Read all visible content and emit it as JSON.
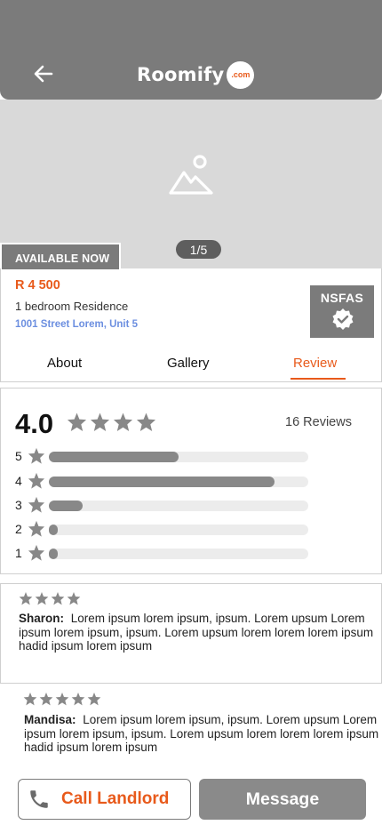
{
  "header": {
    "brand": "Roomify",
    "brand_badge": ".com"
  },
  "hero": {
    "page_indicator": "1/5",
    "availability": "AVAILABLE NOW"
  },
  "listing": {
    "price": "R 4 500",
    "bedrooms": "1 bedroom Residence",
    "address": "1001 Street Lorem, Unit 5",
    "badge": "NSFAS"
  },
  "tabs": [
    {
      "label": "About",
      "active": false
    },
    {
      "label": "Gallery",
      "active": false
    },
    {
      "label": "Review",
      "active": true
    }
  ],
  "rating": {
    "score": "4.0",
    "stars": 4,
    "reviews_count": "16 Reviews",
    "distribution": [
      {
        "label": "5",
        "fraction": 0.5
      },
      {
        "label": "4",
        "fraction": 0.87
      },
      {
        "label": "3",
        "fraction": 0.13
      },
      {
        "label": "2",
        "fraction": 0.02
      },
      {
        "label": "1",
        "fraction": 0.03
      }
    ]
  },
  "reviews": [
    {
      "name": "Sharon:",
      "stars": 4,
      "text": "Lorem ipsum lorem ipsum, ipsum. Lorem upsum Lorem ipsum lorem ipsum, ipsum. Lorem upsum lorem lorem lorem ipsum hadid ipsum lorem ipsum"
    },
    {
      "name": "Mandisa:",
      "stars": 5,
      "text": "Lorem ipsum lorem ipsum, ipsum. Lorem upsum Lorem ipsum lorem ipsum, ipsum. Lorem upsum lorem lorem lorem ipsum hadid ipsum lorem ipsum"
    }
  ],
  "actions": {
    "call_label": "Call Landlord",
    "message_label": "Message"
  },
  "colors": {
    "accent": "#e85a1b",
    "header": "#7b7b7b",
    "link": "#6c8fe0",
    "star": "#888888"
  }
}
